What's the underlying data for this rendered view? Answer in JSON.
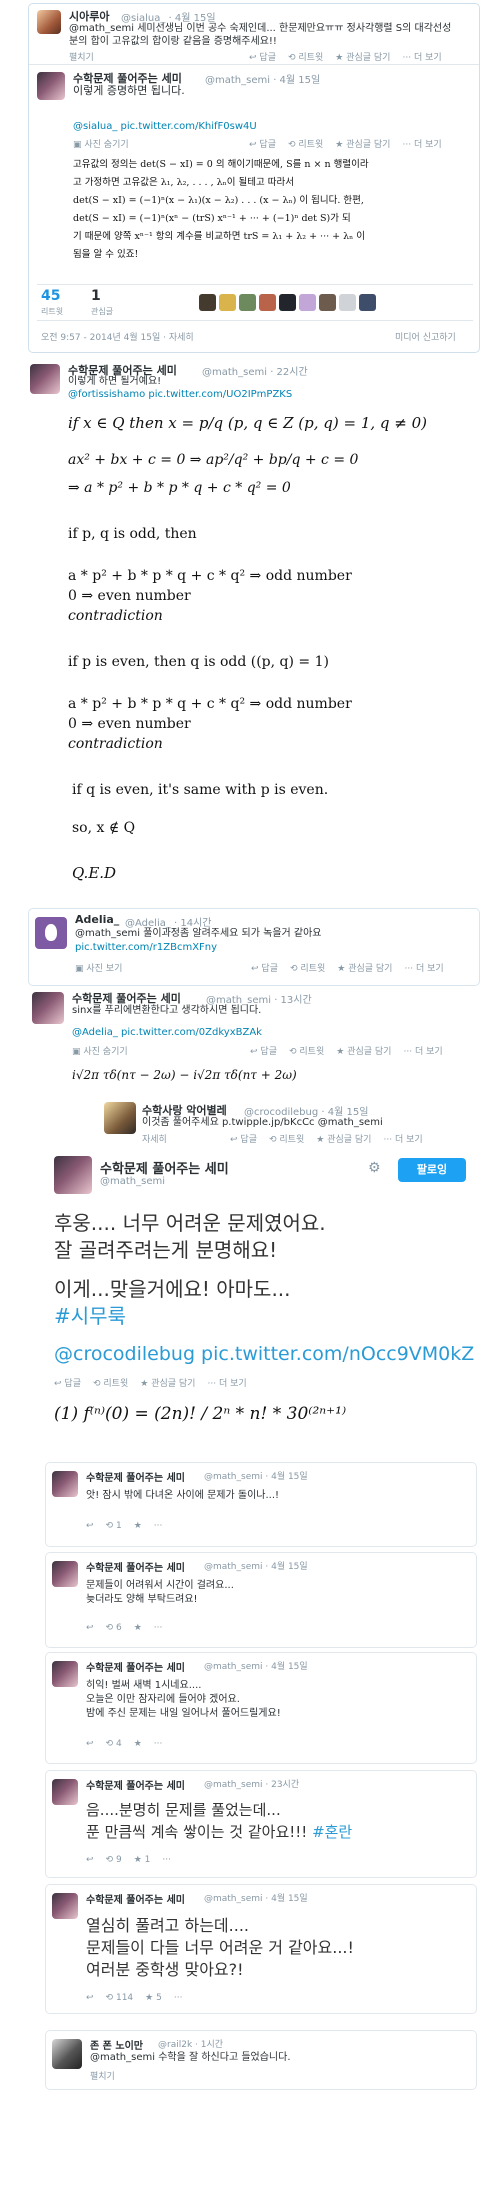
{
  "tweet1": {
    "reply_name": "시아루아",
    "reply_handle": "@sialua_ · 4월 15일",
    "reply_text": "@math_semi 세미선생님 이번 공수 숙제인데... 한문제만요ㅠㅠ 정사각행렬 S의 대각선성분의 합이 고유값의 합이랑 같음을 증명해주세요!!",
    "reply_more": "펼치기",
    "reply_actions": [
      "답글",
      "리트윗",
      "관심글 담기",
      "더 보기"
    ],
    "name": "수학문제 풀어주는 세미",
    "handle": "@math_semi · 4월 15일",
    "text": "이렇게 증명하면 됩니다.",
    "pic_link": "@sialua_ pic.twitter.com/KhifF0sw4U",
    "photo_toggle": "사진 숨기기",
    "actions": [
      "답글",
      "리트윗",
      "관심글 담기",
      "더 보기"
    ],
    "proof_lines": [
      "고유값의 정의는 det(S − xI) = 0 의 해이기때문에, S를 n × n 행렬이라",
      "고 가정하면 고유값은 λ₁, λ₂, . . . , λₙ이 될테고 따라서",
      "det(S − xI) = (−1)ⁿ(x − λ₁)(x − λ₂) . . . (x − λₙ) 이 됩니다. 한편,",
      "det(S − xI) = (−1)ⁿ(xⁿ − (trS) xⁿ⁻¹ + ··· + (−1)ⁿ det S)가 되",
      "기 때문에 양쪽 xⁿ⁻¹ 항의 계수를 비교하면 trS = λ₁ + λ₂ + ··· + λₙ 이",
      "됨을 알 수 있죠!"
    ],
    "retweets": "45",
    "retweets_label": "리트윗",
    "favorites": "1",
    "favorites_label": "관심글",
    "footer_time": "오전 9:57 - 2014년 4월 15일 · 자세히",
    "footer_right": "미디어 신고하기"
  },
  "tweet2": {
    "name": "수학문제 풀어주는 세미",
    "handle": "@math_semi · 22시간",
    "text": "이렇게 하면 될거예요!",
    "pic_link": "@fortissishamo pic.twitter.com/UO2IPmPZKS",
    "math": [
      "if  x ∈ Q  then  x = p/q  (p, q ∈ Z  (p, q) = 1,  q ≠ 0)",
      "ax² + bx + c = 0  ⇒  ap²/q² + bp/q + c = 0",
      "⇒  a * p² + b * p * q + c * q² = 0",
      "if p, q is odd, then",
      "a * p² + b * p * q + c * q² ⇒ odd number",
      "0 ⇒ even number",
      "contradiction",
      "if p is even, then q is odd ((p, q) = 1)",
      "a * p² + b * p * q + c * q² ⇒ odd number",
      "0 ⇒ even number",
      "contradiction",
      "if q is even, it's same with p is even.",
      "so,  x ∉ Q",
      "Q.E.D"
    ]
  },
  "tweet3": {
    "name": "Adelia_",
    "handle": "@Adelia_ · 14시간",
    "text": "@math_semi 풀이과정좀 알려주세요 되가 녹을거 같아요",
    "pic_link": "pic.twitter.com/r1ZBcmXFny",
    "photo_toggle": "사진 보기",
    "actions": [
      "답글",
      "리트윗",
      "관심글 담기",
      "더 보기"
    ]
  },
  "tweet4": {
    "name": "수학문제 풀어주는 세미",
    "handle": "@math_semi · 13시간",
    "text": "sinx를 푸리에변환한다고 생각하시면 됩니다.",
    "pic_link": "@Adelia_ pic.twitter.com/0ZdkyxBZAk",
    "photo_toggle": "사진 숨기기",
    "actions": [
      "답글",
      "리트윗",
      "관심글 담기",
      "더 보기"
    ],
    "formula": "i√2π τδ(nτ − 2ω) − i√2π τδ(nτ + 2ω)"
  },
  "tweet5": {
    "reply_name": "수학사랑 악어별레",
    "reply_handle": "@crocodilebug · 4월 15일",
    "reply_text": "이것좀 풀어주세요 p.twipple.jp/bKcCc @math_semi",
    "reply_more": "자세히",
    "reply_actions": [
      "답글",
      "리트윗",
      "관심글 담기",
      "더 보기"
    ],
    "name": "수학문제 풀어주는 세미",
    "handle": "@math_semi",
    "follow_label": "팔로잉",
    "lines": [
      "후웅.... 너무 어려운 문제였어요.",
      "잘 골려주려는게 분명해요!",
      "",
      "이게...맞을거에요! 아마도...",
      "#시무룩"
    ],
    "link_line": "@crocodilebug pic.twitter.com/nOcc9VM0kZ",
    "actions": [
      "답글",
      "리트윗",
      "관심글 담기",
      "더 보기"
    ],
    "formula": "(1)  f⁽ⁿ⁾(0) = (2n)! / 2ⁿ * n!  * 30⁽²ⁿ⁺¹⁾"
  },
  "tweet6": {
    "name": "수학문제 풀어주는 세미",
    "handle": "@math_semi · 4월 15일",
    "text": "앗! 잠시 밖에 다녀온 사이에 문제가 돌이나...!",
    "retweets": "1",
    "actions": [
      "답글",
      "리트윗",
      "관심글 담기",
      "더 보기"
    ]
  },
  "tweet7": {
    "name": "수학문제 풀어주는 세미",
    "handle": "@math_semi · 4월 15일",
    "lines": [
      "문제들이 어려워서 시간이 걸려요...",
      "늦더라도 양해 부탁드려요!"
    ],
    "retweets": "6",
    "actions": [
      "답글",
      "리트윗",
      "관심글 담기",
      "더 보기"
    ]
  },
  "tweet8": {
    "name": "수학문제 풀어주는 세미",
    "handle": "@math_semi · 4월 15일",
    "lines": [
      "히익! 벌써 새벽 1시네요....",
      "오늘은 이만 잠자리에 들어야 겠어요.",
      "밤에 주신 문제는 내일 일어나서 풀어드릴게요!"
    ],
    "retweets": "4",
    "actions": [
      "답글",
      "리트윗",
      "관심글 담기",
      "더 보기"
    ]
  },
  "tweet9": {
    "name": "수학문제 풀어주는 세미",
    "handle": "@math_semi · 23시간",
    "lines": [
      "음....분명히 문제를 풀었는데...",
      "푼 만큼씩 계속 쌓이는 것 같아요!!! "
    ],
    "hashtag": "#혼란",
    "retweets": "9",
    "favorites": "1",
    "actions": [
      "답글",
      "리트윗",
      "관심글 담기",
      "더 보기"
    ]
  },
  "tweet10": {
    "name": "수학문제 풀어주는 세미",
    "handle": "@math_semi · 4월 15일",
    "lines": [
      "열심히 풀려고 하는데....",
      "문제들이 다들 너무 어려운 거 같아요...!",
      "여러분 중학생 맞아요?!"
    ],
    "retweets": "114",
    "favorites": "5",
    "actions": [
      "답글",
      "리트윗",
      "관심글 담기",
      "더 보기"
    ]
  },
  "tweet11": {
    "name": "존 폰 노이만",
    "handle": "@rail2k · 1시간",
    "text": "@math_semi 수학을 잘 하신다고 들었습니다.",
    "reply_more": "펼치기"
  },
  "icons": {
    "reply": "↩",
    "retweet": "⟲",
    "favorite": "★",
    "more": "···",
    "photo": "▣",
    "gear": "⚙"
  }
}
